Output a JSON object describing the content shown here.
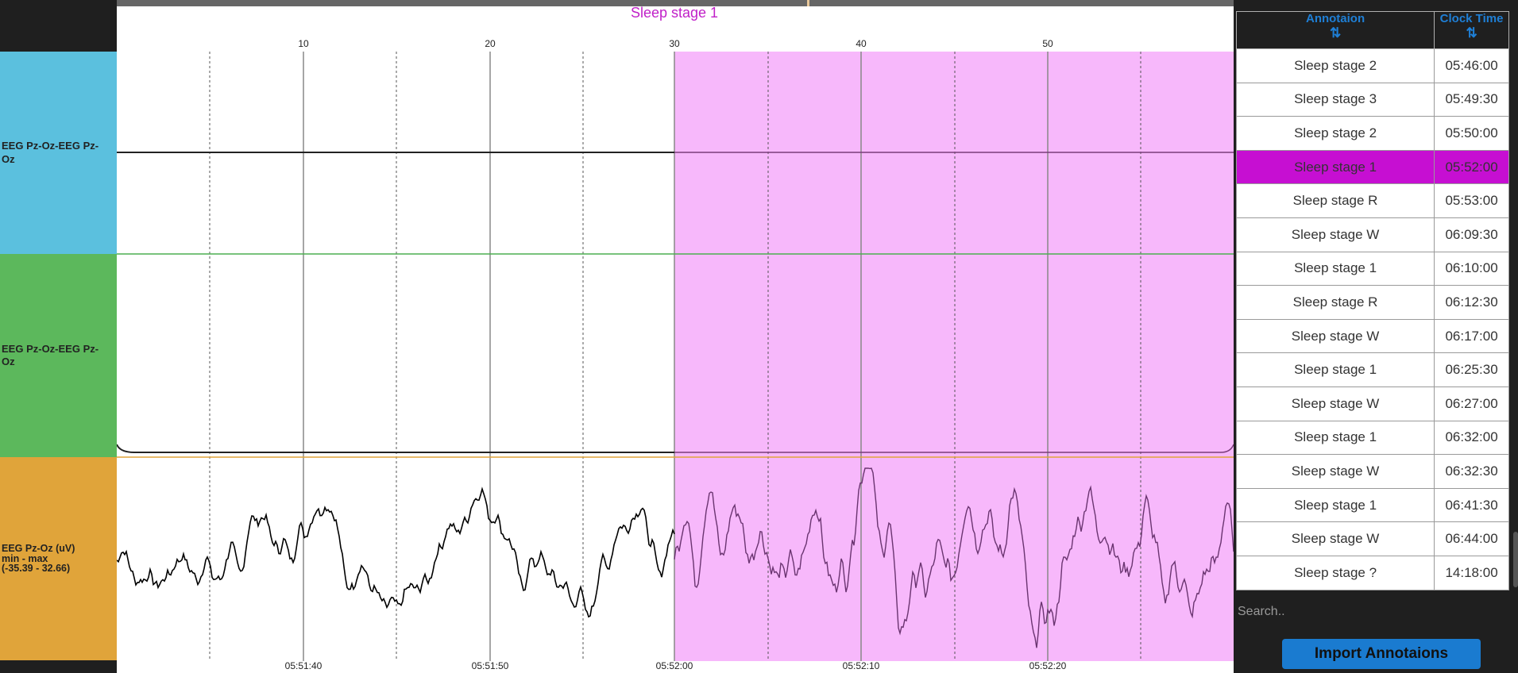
{
  "annotation_title": "Sleep stage 1",
  "channels": [
    {
      "label": "EEG Pz-Oz-EEG Pz-\nOz",
      "color": "#5bc0de"
    },
    {
      "label": "EEG Pz-Oz-EEG Pz-\nOz",
      "color": "#5cb85c"
    },
    {
      "label": "EEG Pz-Oz (uV)\nmin - max\n(-35.39 - 32.66)",
      "color": "#e0a43a"
    }
  ],
  "x_axis": {
    "seconds_ticks": [
      "10",
      "20",
      "30",
      "40",
      "50"
    ],
    "time_ticks": [
      "05:51:40",
      "05:51:50",
      "05:52:00",
      "05:52:10",
      "05:52:20"
    ]
  },
  "highlight_color": "#f7b8fb",
  "table": {
    "col_annotation": "Annotaion",
    "col_time": "Clock Time",
    "sort_glyph": "⇅",
    "selected_index": 3,
    "rows": [
      {
        "annotation": "Sleep stage 2",
        "time": "05:46:00"
      },
      {
        "annotation": "Sleep stage 3",
        "time": "05:49:30"
      },
      {
        "annotation": "Sleep stage 2",
        "time": "05:50:00"
      },
      {
        "annotation": "Sleep stage 1",
        "time": "05:52:00"
      },
      {
        "annotation": "Sleep stage R",
        "time": "05:53:00"
      },
      {
        "annotation": "Sleep stage W",
        "time": "06:09:30"
      },
      {
        "annotation": "Sleep stage 1",
        "time": "06:10:00"
      },
      {
        "annotation": "Sleep stage R",
        "time": "06:12:30"
      },
      {
        "annotation": "Sleep stage W",
        "time": "06:17:00"
      },
      {
        "annotation": "Sleep stage 1",
        "time": "06:25:30"
      },
      {
        "annotation": "Sleep stage W",
        "time": "06:27:00"
      },
      {
        "annotation": "Sleep stage 1",
        "time": "06:32:00"
      },
      {
        "annotation": "Sleep stage W",
        "time": "06:32:30"
      },
      {
        "annotation": "Sleep stage 1",
        "time": "06:41:30"
      },
      {
        "annotation": "Sleep stage W",
        "time": "06:44:00"
      },
      {
        "annotation": "Sleep stage ?",
        "time": "14:18:00"
      }
    ]
  },
  "search_placeholder": "Search..",
  "import_label": "Import Annotaions",
  "icons": {
    "sort": "sort-arrows-icon"
  }
}
